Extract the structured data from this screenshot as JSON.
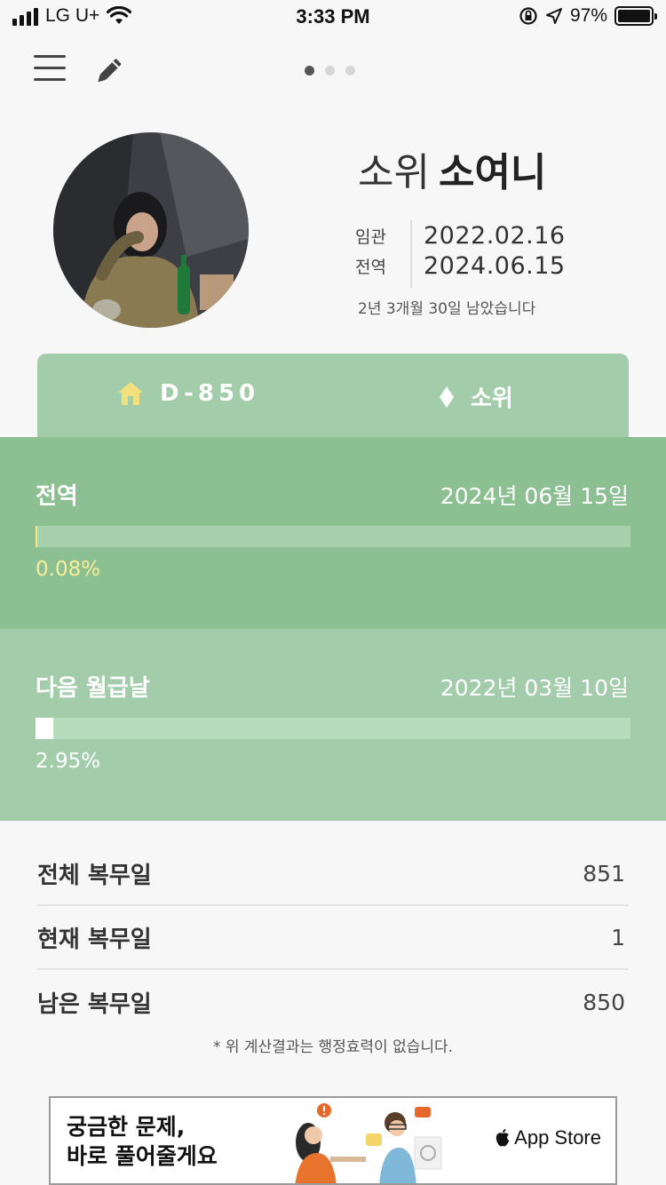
{
  "status_bar": {
    "carrier": "LG U+",
    "time": "3:33 PM",
    "battery": "97%"
  },
  "toolbar": {
    "menu_icon": "hamburger-menu-icon",
    "edit_icon": "pencil-icon",
    "page_count": 3,
    "current_page": 1
  },
  "profile": {
    "rank": "소위",
    "name": "소여니",
    "enlist_label": "임관",
    "enlist_date": "2022.02.16",
    "discharge_label": "전역",
    "discharge_date": "2024.06.15",
    "remaining_text": "2년 3개월 30일 남았습니다"
  },
  "tabs": [
    {
      "icon": "home-icon",
      "label": "D-850",
      "color": "#f2e07c"
    },
    {
      "icon": "diamond-icon",
      "label": "소위",
      "color": "#ffffff"
    }
  ],
  "discharge_progress": {
    "label": "전역",
    "date": "2024년 06월 15일",
    "percent_text": "0.08%",
    "fraction": 0.0008
  },
  "payday_progress": {
    "label": "다음 월급날",
    "date": "2022년 03월 10일",
    "percent_text": "2.95%",
    "fraction": 0.0295
  },
  "stats": [
    {
      "label": "전체 복무일",
      "value": "851"
    },
    {
      "label": "현재 복무일",
      "value": "1"
    },
    {
      "label": "남은 복무일",
      "value": "850"
    }
  ],
  "disclaimer": "* 위 계산결과는 행정효력이 없습니다.",
  "ad": {
    "line1": "궁금한 문제,",
    "line2": "바로 풀어줄게요",
    "store_label": "App Store"
  },
  "colors": {
    "accent_dark": "#8cc093",
    "accent_light": "#a3ccab",
    "highlight": "#f5e88a"
  }
}
